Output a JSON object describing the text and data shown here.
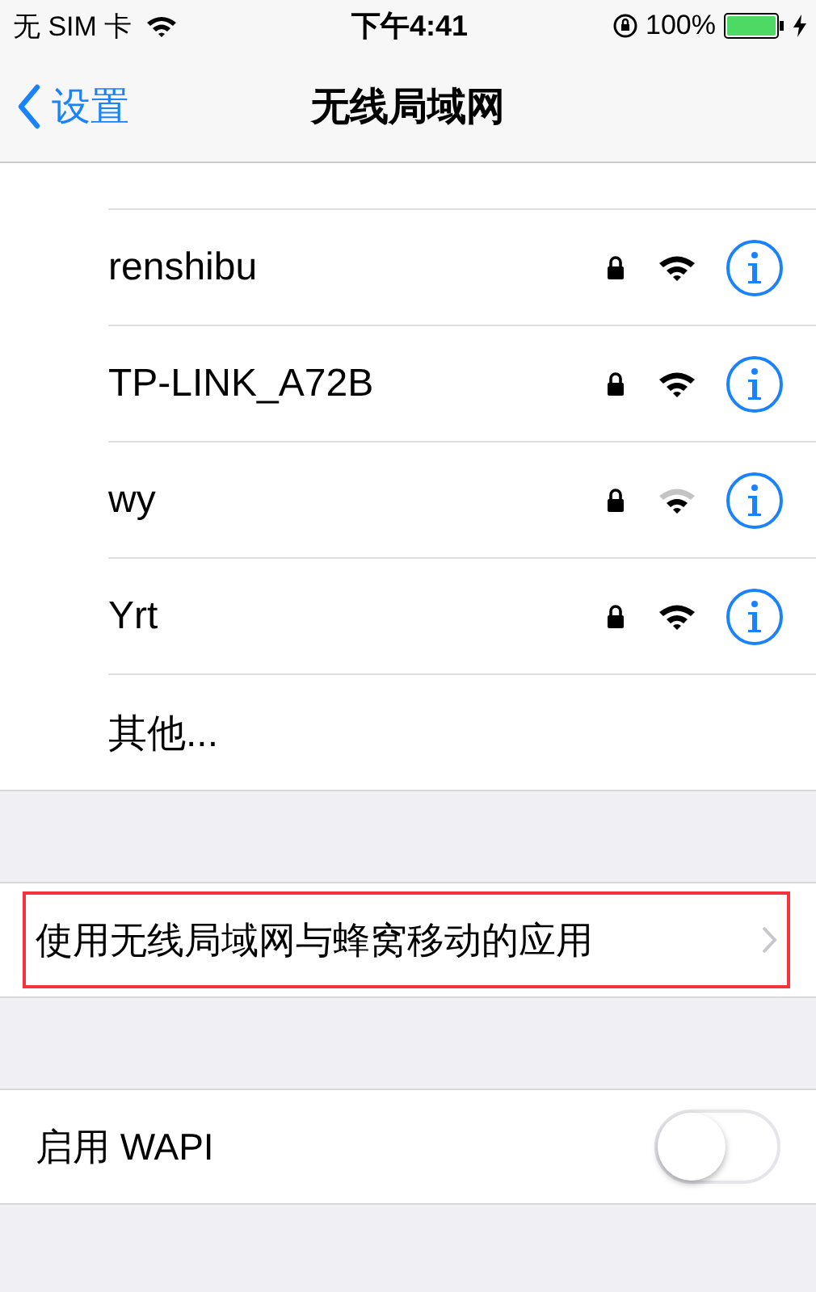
{
  "status_bar": {
    "carrier": "无 SIM 卡",
    "time": "下午4:41",
    "battery": "100%",
    "charging": true
  },
  "nav": {
    "back": "设置",
    "title": "无线局域网"
  },
  "networks": [
    {
      "name": "renshibu",
      "secured": true,
      "weak": false
    },
    {
      "name": "TP-LINK_A72B",
      "secured": true,
      "weak": false
    },
    {
      "name": "wy",
      "secured": true,
      "weak": true
    },
    {
      "name": "Yrt",
      "secured": true,
      "weak": false
    }
  ],
  "other": "其他...",
  "apps_row": {
    "label": "使用无线局域网与蜂窝移动的应用",
    "highlighted": true
  },
  "wapi": {
    "label": "启用 WAPI",
    "on": false
  }
}
